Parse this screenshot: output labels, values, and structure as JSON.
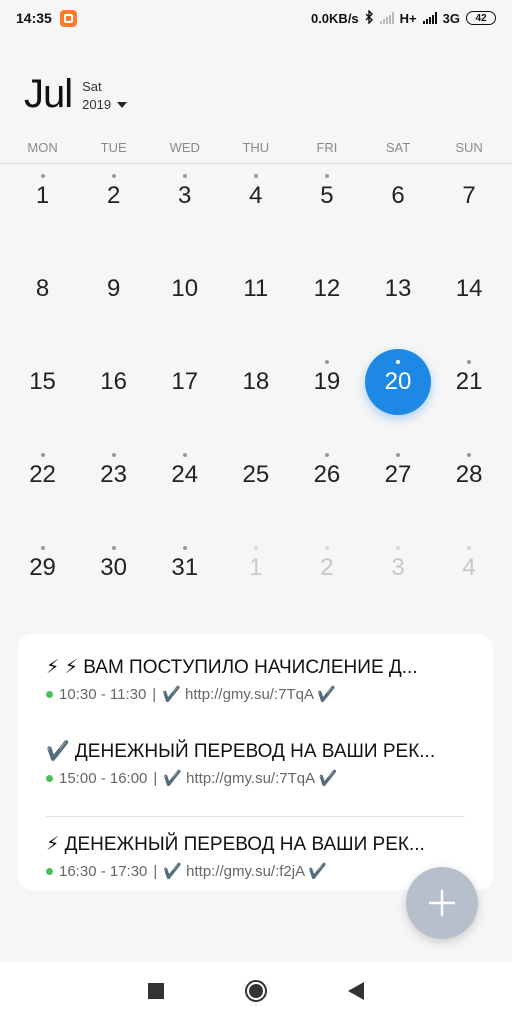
{
  "status_bar": {
    "time": "14:35",
    "net_speed": "0.0KB/s",
    "net1": "H+",
    "net2": "3G",
    "battery": "42"
  },
  "header": {
    "month": "Jul",
    "weekday": "Sat",
    "year": "2019"
  },
  "weekdays": [
    "MON",
    "TUE",
    "WED",
    "THU",
    "FRI",
    "SAT",
    "SUN"
  ],
  "calendar": {
    "days": [
      {
        "n": "1",
        "dot": true
      },
      {
        "n": "2",
        "dot": true
      },
      {
        "n": "3",
        "dot": true
      },
      {
        "n": "4",
        "dot": true
      },
      {
        "n": "5",
        "dot": true
      },
      {
        "n": "6",
        "dot": false
      },
      {
        "n": "7",
        "dot": false
      },
      {
        "n": "8",
        "dot": false
      },
      {
        "n": "9",
        "dot": false
      },
      {
        "n": "10",
        "dot": false
      },
      {
        "n": "11",
        "dot": false
      },
      {
        "n": "12",
        "dot": false
      },
      {
        "n": "13",
        "dot": false
      },
      {
        "n": "14",
        "dot": false
      },
      {
        "n": "15",
        "dot": false
      },
      {
        "n": "16",
        "dot": false
      },
      {
        "n": "17",
        "dot": false
      },
      {
        "n": "18",
        "dot": false
      },
      {
        "n": "19",
        "dot": true
      },
      {
        "n": "20",
        "dot": true,
        "today": true
      },
      {
        "n": "21",
        "dot": true
      },
      {
        "n": "22",
        "dot": true
      },
      {
        "n": "23",
        "dot": true
      },
      {
        "n": "24",
        "dot": true
      },
      {
        "n": "25",
        "dot": false
      },
      {
        "n": "26",
        "dot": true
      },
      {
        "n": "27",
        "dot": true
      },
      {
        "n": "28",
        "dot": true
      },
      {
        "n": "29",
        "dot": true
      },
      {
        "n": "30",
        "dot": true
      },
      {
        "n": "31",
        "dot": true
      },
      {
        "n": "1",
        "dot": true,
        "other": true
      },
      {
        "n": "2",
        "dot": true,
        "other": true
      },
      {
        "n": "3",
        "dot": true,
        "other": true
      },
      {
        "n": "4",
        "dot": true,
        "other": true
      }
    ]
  },
  "events": [
    {
      "title": "⚡ ⚡ ВАМ ПОСТУПИЛО НАЧИСЛЕНИЕ Д...",
      "time": "10:30 - 11:30",
      "link": "✔️ http://gmy.su/:7TqA ✔️"
    },
    {
      "title": "✔️ ДЕНЕЖНЫЙ ПЕРЕВОД НА ВАШИ РЕК...",
      "time": "15:00 - 16:00",
      "link": "✔️ http://gmy.su/:7TqA ✔️"
    },
    {
      "title": "⚡ ДЕНЕЖНЫЙ ПЕРЕВОД НА ВАШИ РЕК...",
      "time": "16:30 - 17:30",
      "link": "✔️ http://gmy.su/:f2jA ✔️"
    }
  ],
  "meta_separator": "|",
  "colors": {
    "accent": "#1e88e5",
    "fab": "#b7bfcd",
    "event_dot": "#45c15a"
  },
  "icons": {
    "fab": "plus-icon",
    "nav": [
      "recents-square-icon",
      "home-circle-icon",
      "back-triangle-icon"
    ]
  }
}
